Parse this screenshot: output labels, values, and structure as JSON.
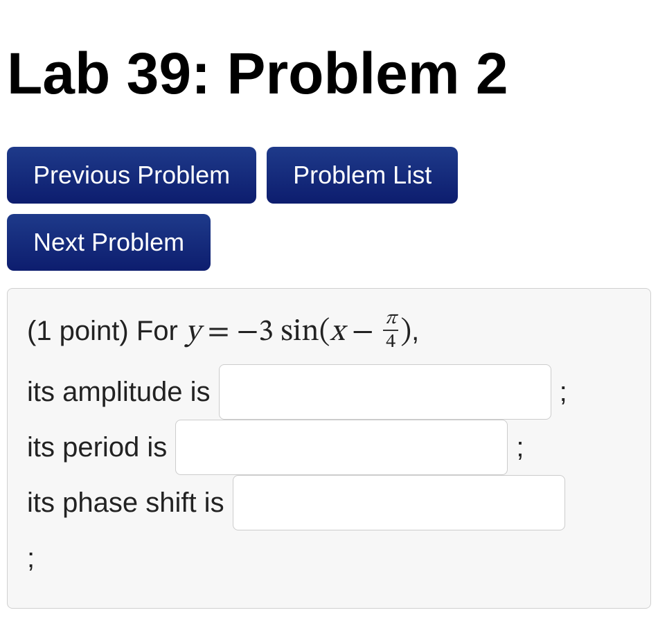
{
  "page": {
    "title": "Lab 39: Problem 2"
  },
  "nav": {
    "previous": "Previous Problem",
    "list": "Problem List",
    "next": "Next Problem"
  },
  "problem": {
    "points_prefix": "(1 point) For ",
    "equation": {
      "y": "y",
      "eq": "=",
      "neg": "−",
      "coeff": "3",
      "func": "sin",
      "open": "(",
      "x": "x",
      "minus": "−",
      "frac_num": "π",
      "frac_den": "4",
      "close": ")",
      "comma": ","
    },
    "amplitude_label": "its amplitude is",
    "period_label": "its period is",
    "phase_label": "its phase shift is",
    "semicolon": ";",
    "answers": {
      "amplitude": "",
      "period": "",
      "phase": ""
    }
  }
}
